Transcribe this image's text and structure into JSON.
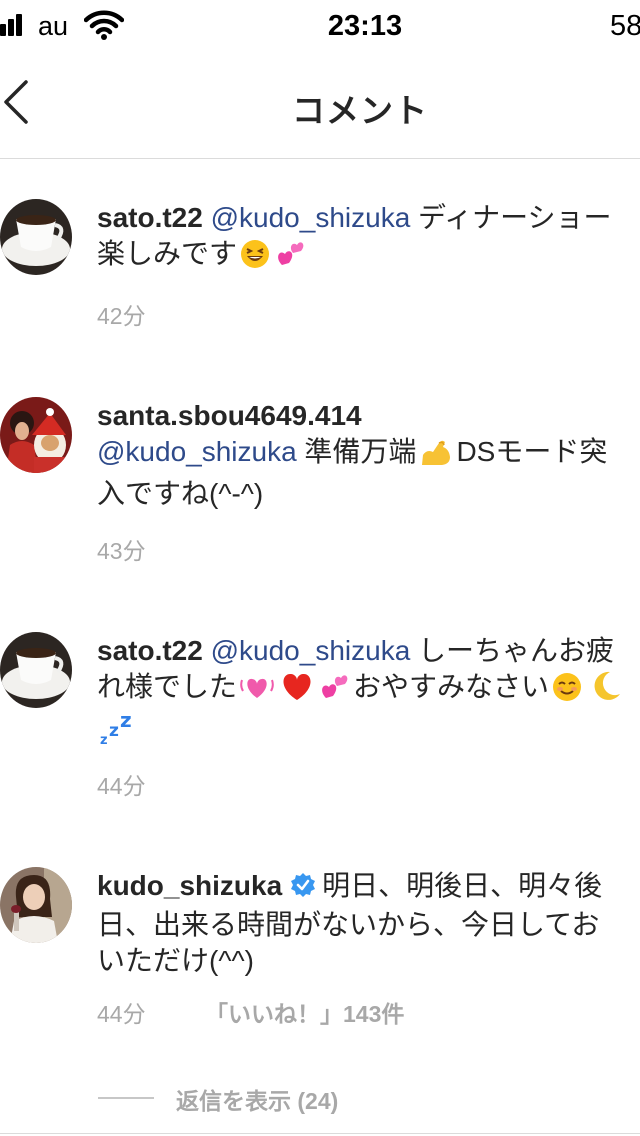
{
  "status_bar": {
    "carrier": "au",
    "time": "23:13",
    "battery": "58"
  },
  "header": {
    "title": "コメント"
  },
  "comments": [
    {
      "username": "sato.t22",
      "mention": "@kudo_shizuka",
      "text_a": " ディナーショー楽しみです",
      "emojis_a": [
        "grinning-squinting-face",
        "two-hearts"
      ],
      "time": "42分"
    },
    {
      "username": "santa.sbou4649.414",
      "mention": "@kudo_shizuka",
      "text_a": " 準備万端",
      "emojis_a": [
        "flexed-biceps"
      ],
      "text_b": "DSモード突入ですね(^-^)",
      "time": "43分"
    },
    {
      "username": "sato.t22",
      "mention": "@kudo_shizuka",
      "text_a": " しーちゃんお疲れ様でした",
      "emojis_a": [
        "beating-heart",
        "red-heart",
        "two-hearts"
      ],
      "text_b": "おやすみなさい",
      "emojis_b": [
        "smiling-face",
        "crescent-moon",
        "zzz"
      ],
      "time": "44分"
    },
    {
      "username": "kudo_shizuka",
      "verified": true,
      "text_a": "明日、明後日、明々後日、出来る時間がないから、今日しておいただけ(^^)",
      "time": "44分",
      "likes": "「いいね！」143件",
      "view_replies": "返信を表示 (24)"
    }
  ],
  "colors": {
    "mention": "#2e4a8a",
    "meta": "#a8a8a8",
    "verified": "#3897f0",
    "divider": "#dbdbdb"
  }
}
